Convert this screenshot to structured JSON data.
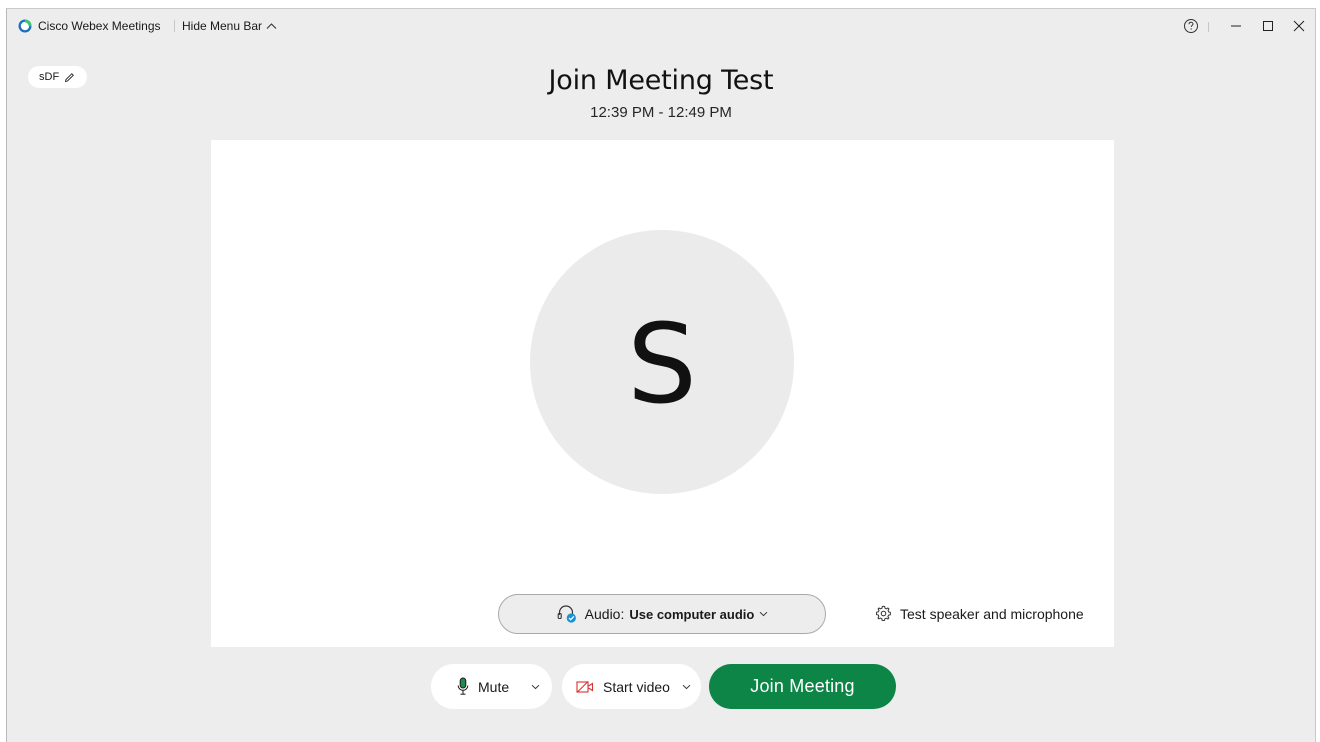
{
  "titlebar": {
    "app_title": "Cisco Webex Meetings",
    "hide_menu_label": "Hide Menu Bar",
    "logo_icon": "webex-logo-icon",
    "help_icon": "help-icon",
    "window_controls": [
      "minimize-icon",
      "maximize-icon",
      "close-icon"
    ]
  },
  "user": {
    "name_pill": "sDF",
    "edit_icon": "pencil-icon",
    "avatar_letter": "S"
  },
  "meeting": {
    "title": "Join Meeting Test",
    "time": "12:39 PM - 12:49 PM"
  },
  "audio": {
    "label": "Audio:",
    "value": "Use computer audio",
    "icon": "headset-icon",
    "test_label": "Test speaker and microphone",
    "test_icon": "gear-icon"
  },
  "controls": {
    "mute_label": "Mute",
    "mute_icon": "microphone-icon",
    "video_label": "Start video",
    "video_icon": "video-off-icon",
    "join_label": "Join Meeting"
  },
  "colors": {
    "join_green": "#0d8547",
    "video_off_red": "#d63333",
    "mic_green": "#1f8a4c",
    "headset_check_blue": "#1a90d6",
    "window_bg": "#ededed"
  }
}
